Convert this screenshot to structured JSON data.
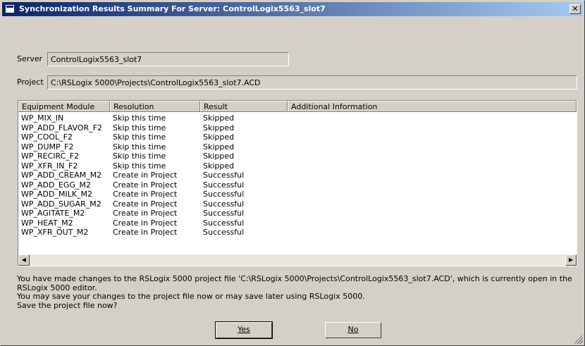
{
  "window": {
    "title": "Synchronization Results Summary For Server: ControlLogix5563_slot7",
    "close_glyph": "✕"
  },
  "server": {
    "label": "Server",
    "value": "ControlLogix5563_slot7"
  },
  "project": {
    "label": "Project",
    "value": "C:\\RSLogix 5000\\Projects\\ControlLogix5563_slot7.ACD"
  },
  "table": {
    "columns": [
      "Equipment Module",
      "Resolution",
      "Result",
      "Additional Information"
    ],
    "rows": [
      [
        "WP_MIX_IN",
        "Skip this time",
        "Skipped",
        ""
      ],
      [
        "WP_ADD_FLAVOR_F2",
        "Skip this time",
        "Skipped",
        ""
      ],
      [
        "WP_COOL_F2",
        "Skip this time",
        "Skipped",
        ""
      ],
      [
        "WP_DUMP_F2",
        "Skip this time",
        "Skipped",
        ""
      ],
      [
        "WP_RECIRC_F2",
        "Skip this time",
        "Skipped",
        ""
      ],
      [
        "WP_XFR_IN_F2",
        "Skip this time",
        "Skipped",
        ""
      ],
      [
        "WP_ADD_CREAM_M2",
        "Create in Project",
        "Successful",
        ""
      ],
      [
        "WP_ADD_EGG_M2",
        "Create in Project",
        "Successful",
        ""
      ],
      [
        "WP_ADD_MILK_M2",
        "Create in Project",
        "Successful",
        ""
      ],
      [
        "WP_ADD_SUGAR_M2",
        "Create in Project",
        "Successful",
        ""
      ],
      [
        "WP_AGITATE_M2",
        "Create in Project",
        "Successful",
        ""
      ],
      [
        "WP_HEAT_M2",
        "Create in Project",
        "Successful",
        ""
      ],
      [
        "WP_XFR_OUT_M2",
        "Create in Project",
        "Successful",
        ""
      ]
    ]
  },
  "scrollbar": {
    "left_glyph": "◀",
    "right_glyph": "▶"
  },
  "message": {
    "line1": "You have made changes to the RSLogix 5000 project file 'C:\\RSLogix 5000\\Projects\\ControlLogix5563_slot7.ACD', which is currently open in the RSLogix 5000 editor.",
    "line2": "You may save your changes to the project file now or may save later using RSLogix 5000.",
    "line3": "Save the project file now?"
  },
  "buttons": {
    "yes": "Yes",
    "no": "No"
  }
}
